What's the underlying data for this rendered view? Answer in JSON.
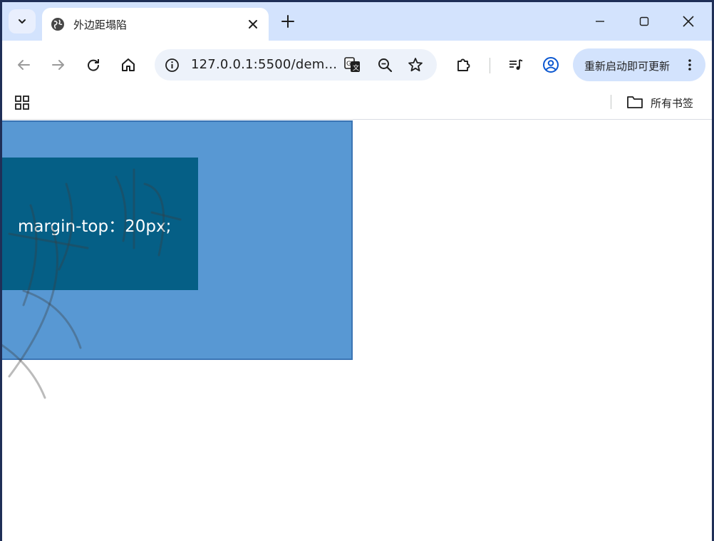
{
  "tab": {
    "title": "外边距塌陷"
  },
  "toolbar": {
    "url": "127.0.0.1:5500/dem...",
    "update_label": "重新启动即可更新"
  },
  "bookmarks": {
    "all_bookmarks": "所有书签"
  },
  "content": {
    "inner_text": "margin-top：20px;"
  },
  "colors": {
    "outer_box": "#5898d3",
    "inner_box": "#055f86",
    "tabstrip": "#d3e3fd"
  },
  "icons": [
    "chevron-down-icon",
    "globe-icon",
    "close-icon",
    "plus-icon",
    "minimize-icon",
    "maximize-icon",
    "window-close-icon",
    "back-icon",
    "forward-icon",
    "reload-icon",
    "home-icon",
    "info-icon",
    "translate-icon",
    "zoom-icon",
    "star-icon",
    "extensions-icon",
    "media-icon",
    "profile-icon",
    "more-icon",
    "apps-icon",
    "folder-icon"
  ]
}
